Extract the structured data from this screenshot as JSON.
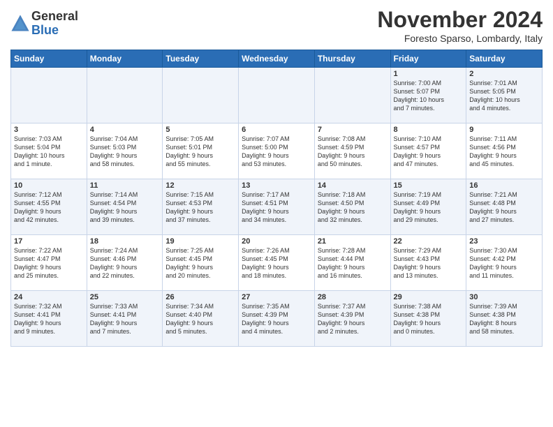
{
  "logo": {
    "general": "General",
    "blue": "Blue"
  },
  "title": "November 2024",
  "location": "Foresto Sparso, Lombardy, Italy",
  "days_header": [
    "Sunday",
    "Monday",
    "Tuesday",
    "Wednesday",
    "Thursday",
    "Friday",
    "Saturday"
  ],
  "weeks": [
    {
      "cells": [
        {
          "day": "",
          "info": ""
        },
        {
          "day": "",
          "info": ""
        },
        {
          "day": "",
          "info": ""
        },
        {
          "day": "",
          "info": ""
        },
        {
          "day": "",
          "info": ""
        },
        {
          "day": "1",
          "info": "Sunrise: 7:00 AM\nSunset: 5:07 PM\nDaylight: 10 hours\nand 7 minutes."
        },
        {
          "day": "2",
          "info": "Sunrise: 7:01 AM\nSunset: 5:05 PM\nDaylight: 10 hours\nand 4 minutes."
        }
      ]
    },
    {
      "cells": [
        {
          "day": "3",
          "info": "Sunrise: 7:03 AM\nSunset: 5:04 PM\nDaylight: 10 hours\nand 1 minute."
        },
        {
          "day": "4",
          "info": "Sunrise: 7:04 AM\nSunset: 5:03 PM\nDaylight: 9 hours\nand 58 minutes."
        },
        {
          "day": "5",
          "info": "Sunrise: 7:05 AM\nSunset: 5:01 PM\nDaylight: 9 hours\nand 55 minutes."
        },
        {
          "day": "6",
          "info": "Sunrise: 7:07 AM\nSunset: 5:00 PM\nDaylight: 9 hours\nand 53 minutes."
        },
        {
          "day": "7",
          "info": "Sunrise: 7:08 AM\nSunset: 4:59 PM\nDaylight: 9 hours\nand 50 minutes."
        },
        {
          "day": "8",
          "info": "Sunrise: 7:10 AM\nSunset: 4:57 PM\nDaylight: 9 hours\nand 47 minutes."
        },
        {
          "day": "9",
          "info": "Sunrise: 7:11 AM\nSunset: 4:56 PM\nDaylight: 9 hours\nand 45 minutes."
        }
      ]
    },
    {
      "cells": [
        {
          "day": "10",
          "info": "Sunrise: 7:12 AM\nSunset: 4:55 PM\nDaylight: 9 hours\nand 42 minutes."
        },
        {
          "day": "11",
          "info": "Sunrise: 7:14 AM\nSunset: 4:54 PM\nDaylight: 9 hours\nand 39 minutes."
        },
        {
          "day": "12",
          "info": "Sunrise: 7:15 AM\nSunset: 4:53 PM\nDaylight: 9 hours\nand 37 minutes."
        },
        {
          "day": "13",
          "info": "Sunrise: 7:17 AM\nSunset: 4:51 PM\nDaylight: 9 hours\nand 34 minutes."
        },
        {
          "day": "14",
          "info": "Sunrise: 7:18 AM\nSunset: 4:50 PM\nDaylight: 9 hours\nand 32 minutes."
        },
        {
          "day": "15",
          "info": "Sunrise: 7:19 AM\nSunset: 4:49 PM\nDaylight: 9 hours\nand 29 minutes."
        },
        {
          "day": "16",
          "info": "Sunrise: 7:21 AM\nSunset: 4:48 PM\nDaylight: 9 hours\nand 27 minutes."
        }
      ]
    },
    {
      "cells": [
        {
          "day": "17",
          "info": "Sunrise: 7:22 AM\nSunset: 4:47 PM\nDaylight: 9 hours\nand 25 minutes."
        },
        {
          "day": "18",
          "info": "Sunrise: 7:24 AM\nSunset: 4:46 PM\nDaylight: 9 hours\nand 22 minutes."
        },
        {
          "day": "19",
          "info": "Sunrise: 7:25 AM\nSunset: 4:45 PM\nDaylight: 9 hours\nand 20 minutes."
        },
        {
          "day": "20",
          "info": "Sunrise: 7:26 AM\nSunset: 4:45 PM\nDaylight: 9 hours\nand 18 minutes."
        },
        {
          "day": "21",
          "info": "Sunrise: 7:28 AM\nSunset: 4:44 PM\nDaylight: 9 hours\nand 16 minutes."
        },
        {
          "day": "22",
          "info": "Sunrise: 7:29 AM\nSunset: 4:43 PM\nDaylight: 9 hours\nand 13 minutes."
        },
        {
          "day": "23",
          "info": "Sunrise: 7:30 AM\nSunset: 4:42 PM\nDaylight: 9 hours\nand 11 minutes."
        }
      ]
    },
    {
      "cells": [
        {
          "day": "24",
          "info": "Sunrise: 7:32 AM\nSunset: 4:41 PM\nDaylight: 9 hours\nand 9 minutes."
        },
        {
          "day": "25",
          "info": "Sunrise: 7:33 AM\nSunset: 4:41 PM\nDaylight: 9 hours\nand 7 minutes."
        },
        {
          "day": "26",
          "info": "Sunrise: 7:34 AM\nSunset: 4:40 PM\nDaylight: 9 hours\nand 5 minutes."
        },
        {
          "day": "27",
          "info": "Sunrise: 7:35 AM\nSunset: 4:39 PM\nDaylight: 9 hours\nand 4 minutes."
        },
        {
          "day": "28",
          "info": "Sunrise: 7:37 AM\nSunset: 4:39 PM\nDaylight: 9 hours\nand 2 minutes."
        },
        {
          "day": "29",
          "info": "Sunrise: 7:38 AM\nSunset: 4:38 PM\nDaylight: 9 hours\nand 0 minutes."
        },
        {
          "day": "30",
          "info": "Sunrise: 7:39 AM\nSunset: 4:38 PM\nDaylight: 8 hours\nand 58 minutes."
        }
      ]
    }
  ]
}
